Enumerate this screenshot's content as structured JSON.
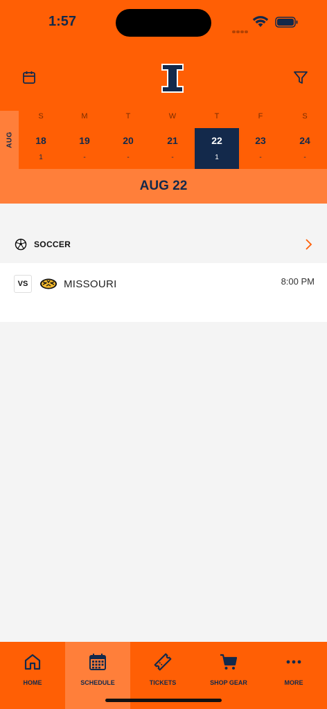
{
  "status": {
    "time": "1:57"
  },
  "colors": {
    "primary": "#ff5f05",
    "secondary": "#13294b",
    "light": "#ff7f3a"
  },
  "header": {
    "left_icon": "calendar-icon",
    "logo": "illinois-block-i-logo",
    "right_icon": "filter-icon"
  },
  "week": {
    "month": "AUG",
    "days": [
      {
        "dow": "S",
        "num": "18",
        "count": "1"
      },
      {
        "dow": "M",
        "num": "19",
        "count": "-"
      },
      {
        "dow": "T",
        "num": "20",
        "count": "-"
      },
      {
        "dow": "W",
        "num": "21",
        "count": "-"
      },
      {
        "dow": "T",
        "num": "22",
        "count": "1"
      },
      {
        "dow": "F",
        "num": "23",
        "count": "-"
      },
      {
        "dow": "S",
        "num": "24",
        "count": "-"
      }
    ],
    "selected_index": 4
  },
  "date_banner": "AUG 22",
  "sport": {
    "icon": "soccer-ball-icon",
    "label": "SOCCER"
  },
  "game": {
    "vs": "VS",
    "opponent": "MISSOURI",
    "opponent_logo": "missouri-tiger-logo",
    "time": "8:00 PM"
  },
  "tabs": [
    {
      "label": "HOME",
      "icon": "home-icon"
    },
    {
      "label": "SCHEDULE",
      "icon": "calendar-grid-icon",
      "active": true
    },
    {
      "label": "TICKETS",
      "icon": "ticket-icon"
    },
    {
      "label": "SHOP GEAR",
      "icon": "cart-icon"
    },
    {
      "label": "MORE",
      "icon": "more-icon"
    }
  ]
}
